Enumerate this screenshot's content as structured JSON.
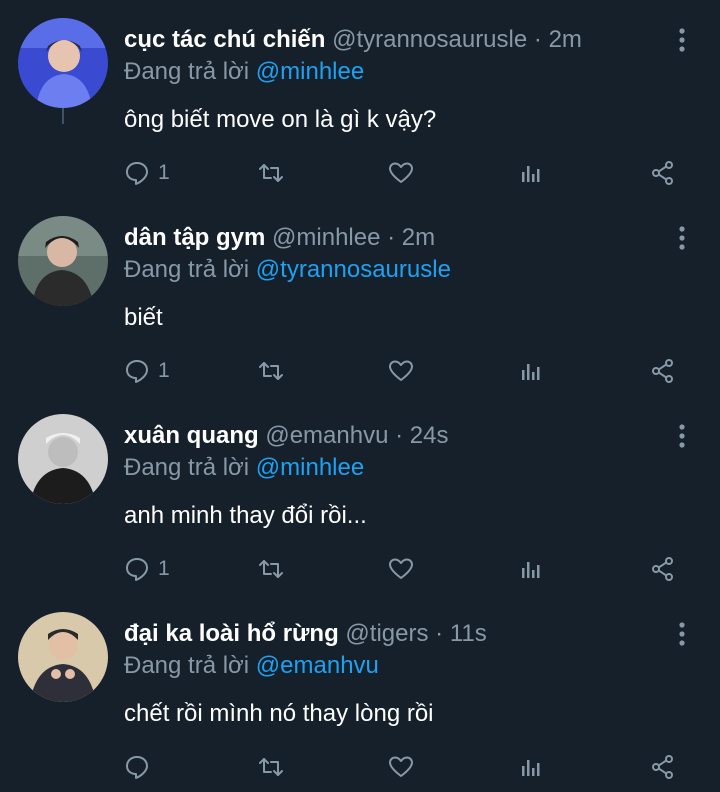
{
  "tweets": [
    {
      "name": "cục tác chú chiến",
      "handle": "@tyrannosaurusle",
      "time": "2m",
      "replying_prefix": "Đang trả lời",
      "replying_to": "@minhlee",
      "text": "ông biết move on là gì k vậy?",
      "reply_count": "1",
      "avatar_color": "#3a4bd1"
    },
    {
      "name": "dân tập gym",
      "handle": "@minhlee",
      "time": "2m",
      "replying_prefix": "Đang trả lời",
      "replying_to": "@tyrannosaurusle",
      "text": "biết",
      "reply_count": "1",
      "avatar_color": "#4a5a55"
    },
    {
      "name": "xuân quang",
      "handle": "@emanhvu",
      "time": "24s",
      "replying_prefix": "Đang trả lời",
      "replying_to": "@minhlee",
      "text": "anh minh thay đổi rồi...",
      "reply_count": "1",
      "avatar_color": "#2b2b2b"
    },
    {
      "name": "đại ka loài hổ rừng",
      "handle": "@tigers",
      "time": "11s",
      "replying_prefix": "Đang trả lời",
      "replying_to": "@emanhvu",
      "text": "chết rồi mình nó thay lòng rồi",
      "reply_count": "",
      "avatar_color": "#c9b79a"
    }
  ],
  "separator": "·",
  "icons": [
    "reply-icon",
    "retweet-icon",
    "like-icon",
    "analytics-icon",
    "share-icon",
    "more-icon"
  ],
  "colors": {
    "background": "#15202b",
    "secondary_text": "#8899a6",
    "link": "#1da1f2",
    "primary_text": "#ffffff"
  }
}
